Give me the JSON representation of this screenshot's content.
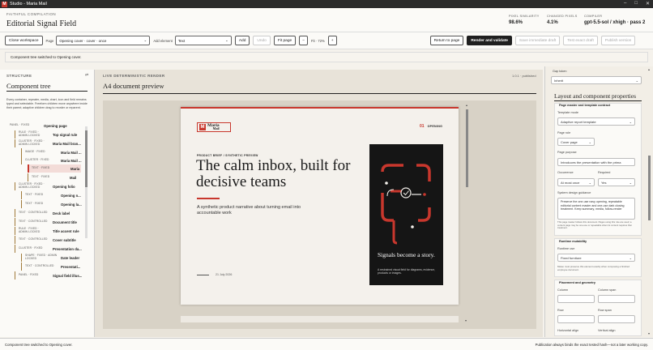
{
  "window": {
    "title": "Studio - Maria Mail",
    "logo_letter": "M"
  },
  "header": {
    "eyebrow": "FAITHFUL COMPILATION",
    "title": "Editorial Signal Field",
    "stats": [
      {
        "label": "PIXEL SIMILARITY",
        "value": "98.6%"
      },
      {
        "label": "CHANGED PIXELS",
        "value": "4.1%"
      },
      {
        "label": "COMPILER",
        "value": "gpt-5.5-sol / xhigh · pass 2"
      }
    ]
  },
  "toolbar": {
    "close_workspace": "Close workspace",
    "page_label": "Page",
    "page_value": "Opening cover · cover · once",
    "add_element_label": "Add element",
    "add_element_value": "Text",
    "add": "Add",
    "undo": "Undo",
    "fit_page": "Fit page",
    "zoom_out": "−",
    "zoom_label": "Fit · 72%",
    "zoom_in": "+",
    "return_to_page": "Return to page",
    "render_validate": "Render and validate",
    "save_draft": "Save immediate draft",
    "test_draft": "Test exact draft",
    "publish": "Publish version"
  },
  "banner": {
    "text": "Component tree switched to Opening cover."
  },
  "structure": {
    "eyebrow": "STRUCTURE",
    "collapse": "⇄",
    "title": "Component tree",
    "description": "Every container, repeater, media, chart, icon and field remains typed and selectable. Freeform children move anywhere inside their parent; adaptive children drag to reorder or reparent.",
    "rows": [
      {
        "meta": "PANEL · FIXED",
        "name": "Opening page"
      },
      {
        "meta": "RULE · FIXED · ADMIN LOCKED",
        "name": "Top signal rule"
      },
      {
        "meta": "CLUSTER · FIXED · ADMIN LOCKED",
        "name": "Maria Mail bran..."
      },
      {
        "meta": "IMAGE · FIXED",
        "name": "Maria Mail ..."
      },
      {
        "meta": "CLUSTER · FIXED",
        "name": "Maria Mail ..."
      },
      {
        "meta": "TEXT · FIXED",
        "name": "Maria"
      },
      {
        "meta": "TEXT · FIXED",
        "name": "Mail"
      },
      {
        "meta": "CLUSTER · FIXED · ADMIN LOCKED",
        "name": "Opening folio"
      },
      {
        "meta": "TEXT · FIXED",
        "name": "Opening n..."
      },
      {
        "meta": "TEXT · FIXED",
        "name": "Opening la..."
      },
      {
        "meta": "TEXT · CONTROLLED",
        "name": "Deck label"
      },
      {
        "meta": "TEXT · CONTROLLED",
        "name": "Document title"
      },
      {
        "meta": "RULE · FIXED · ADMIN LOCKED",
        "name": "Title accent rule"
      },
      {
        "meta": "TEXT · CONTROLLED",
        "name": "Cover subtitle"
      },
      {
        "meta": "CLUSTER · FIXED",
        "name": "Presentation da..."
      },
      {
        "meta": "SHAPE · FIXED · ADMIN LOCKED",
        "name": "Date leader"
      },
      {
        "meta": "TEXT · CONTROLLED",
        "name": "Presentati..."
      },
      {
        "meta": "PANEL · FIXED",
        "name": "Signal field illus..."
      }
    ]
  },
  "render": {
    "eyebrow": "LIVE DETERMINISTIC RENDER",
    "title": "A4 document preview",
    "version": "1.0.1 · published"
  },
  "doc": {
    "brand_top": "Maria",
    "brand_bottom": "Mail",
    "folio_num": "01",
    "folio_label": "OPENING",
    "deck_label": "PRODUCT BRIEF / SYNTHETIC PREVIEW",
    "title": "The calm inbox, built for decisive teams",
    "subtitle": "A synthetic product narrative about turning email into accountable work",
    "date": "21 July 2026",
    "card_title": "Signals become a story.",
    "card_caption": "A restrained visual field for diagrams, evidence, products or images."
  },
  "props": {
    "gap_label": "Gap token",
    "gap_value": "Inherit",
    "title": "Layout and component properties",
    "contract_title": "Page master and template contract",
    "template_mode_label": "Template mode",
    "template_mode_value": "Adaptive report template",
    "page_role_label": "Page role",
    "page_role_value": "Cover page",
    "page_purpose_label": "Page purpose",
    "page_purpose_value": "Introduces the presentation with the prima",
    "occurrence_label": "Occurrence",
    "occurrence_value": "At most once",
    "required_label": "Required",
    "required_value": "Yes",
    "guidance_label": "System design guidance",
    "guidance_value": "Preserve the one-use navy opening, repeatable editorial content master and one-use dark closing treatment. Keep summary, media, follow-render",
    "guidance_note": "This page master follows this document. Pages using this role are used; a content page may be one-use or repeatable when its content requires that treatment.",
    "mutability_title": "Runtime mutability",
    "runtime_use_label": "Runtime use",
    "runtime_use_value": "Fixed furniture",
    "runtime_note": "Mateo must preserve this element exactly when composing a finished employee document.",
    "placement_title": "Placement and geometry",
    "column_label": "Column",
    "column_span_label": "Column span",
    "row_label": "Row",
    "row_span_label": "Row span",
    "h_align_label": "Horizontal align",
    "v_align_label": "Vertical align"
  },
  "footer": {
    "left": "Component tree switched to Opening cover.",
    "right": "Publication always binds the exact tested hash—not a later working copy."
  },
  "colors": {
    "accent": "#c8372d",
    "dark": "#1f1f1f",
    "navy_card": "#151515"
  }
}
